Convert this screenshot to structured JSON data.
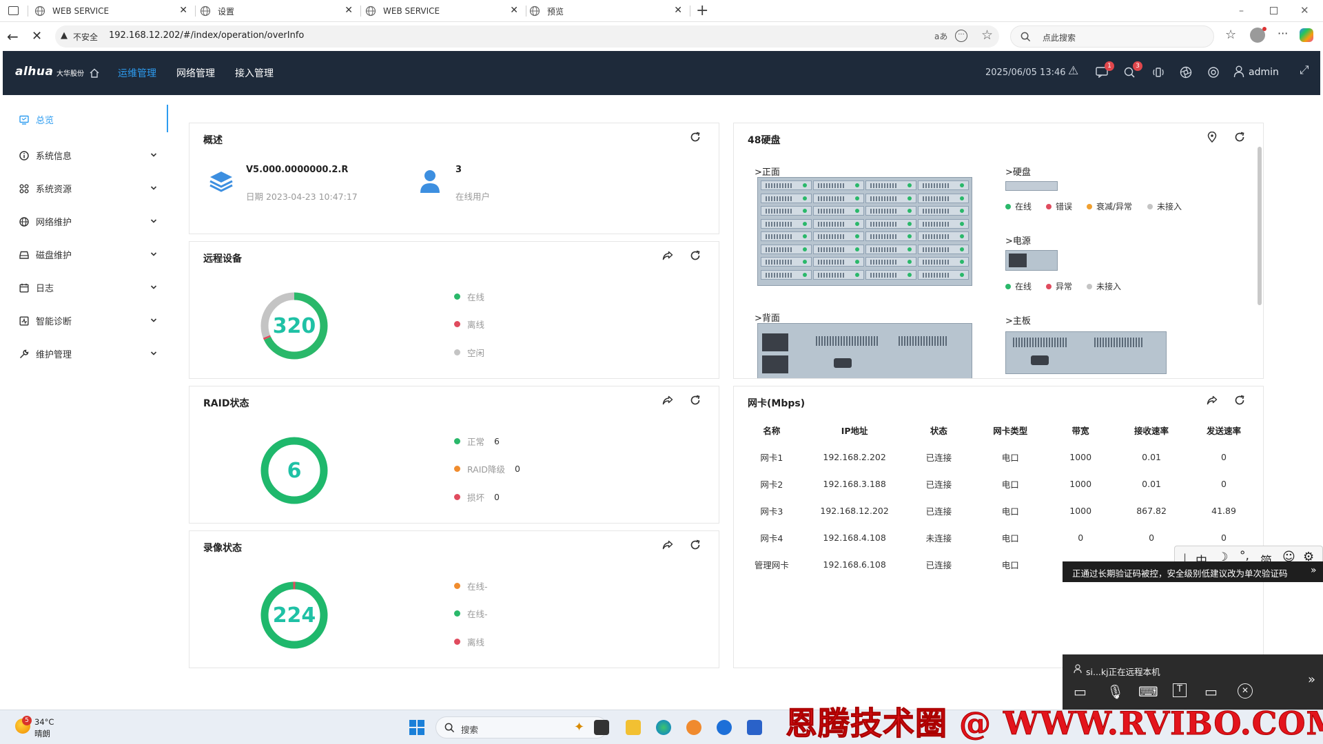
{
  "browser": {
    "tabs": [
      {
        "label": "WEB SERVICE"
      },
      {
        "label": "设置"
      },
      {
        "label": "WEB SERVICE"
      },
      {
        "label": "预览"
      }
    ],
    "insecure_label": "不安全",
    "url": "192.168.12.202/#/index/operation/overInfo",
    "search_placeholder": "点此搜索"
  },
  "header": {
    "brand": "alhua",
    "brand_sub": "大华股份",
    "nav": [
      {
        "label": "运维管理",
        "active": true
      },
      {
        "label": "网络管理",
        "active": false
      },
      {
        "label": "接入管理",
        "active": false
      }
    ],
    "datetime": "2025/06/05 13:46",
    "msg_badge": "1",
    "alert_badge": "3",
    "user": "admin",
    "accent": "#2d9cf0"
  },
  "sidebar": {
    "items": [
      {
        "label": "总览",
        "icon": "monitor-icon"
      },
      {
        "label": "系统信息",
        "icon": "info-icon"
      },
      {
        "label": "系统资源",
        "icon": "grid-icon"
      },
      {
        "label": "网络维护",
        "icon": "globe-icon"
      },
      {
        "label": "磁盘维护",
        "icon": "disk-icon"
      },
      {
        "label": "日志",
        "icon": "calendar-icon"
      },
      {
        "label": "智能诊断",
        "icon": "diagnose-icon"
      },
      {
        "label": "维护管理",
        "icon": "wrench-icon"
      }
    ]
  },
  "overview": {
    "title": "概述",
    "version": "V5.000.0000000.2.R",
    "date_label": "日期 2023-04-23 10:47:17",
    "online_users": "3",
    "online_users_label": "在线用户"
  },
  "remote": {
    "title": "远程设备",
    "total": "320",
    "legend": [
      {
        "label": "在线",
        "color": "#2ab86a"
      },
      {
        "label": "离线",
        "color": "#e04b5e"
      },
      {
        "label": "空闲",
        "color": "#c4c4c4"
      }
    ],
    "segments": [
      {
        "label": "在线",
        "fraction": 0.68,
        "color": "#2ab86a"
      },
      {
        "label": "离线",
        "fraction": 0.01,
        "color": "#e04b5e"
      },
      {
        "label": "空闲",
        "fraction": 0.31,
        "color": "#c4c4c4"
      }
    ]
  },
  "raid": {
    "title": "RAID状态",
    "total": "6",
    "legend": [
      {
        "label": "正常",
        "value": "6",
        "color": "#2ab86a"
      },
      {
        "label": "RAID降级",
        "value": "0",
        "color": "#f08c2e"
      },
      {
        "label": "损坏",
        "value": "0",
        "color": "#e04b5e"
      }
    ]
  },
  "record": {
    "title": "录像状态",
    "total": "224",
    "legend": [
      {
        "label": "在线-",
        "color": "#f08c2e"
      },
      {
        "label": "在线-",
        "color": "#2ab86a"
      },
      {
        "label": "离线",
        "color": "#e04b5e"
      }
    ]
  },
  "disks": {
    "title": "48硬盘",
    "front_label": ">正面",
    "back_label": ">背面",
    "disk_label": ">硬盘",
    "power_label": ">电源",
    "board_label": ">主板",
    "disk_legend": [
      {
        "label": "在线",
        "color": "#2ab86a"
      },
      {
        "label": "错误",
        "color": "#e04b5e"
      },
      {
        "label": "衰减/异常",
        "color": "#f0a030"
      },
      {
        "label": "未接入",
        "color": "#c4c4c4"
      }
    ],
    "power_legend": [
      {
        "label": "在线",
        "color": "#2ab86a"
      },
      {
        "label": "异常",
        "color": "#e04b5e"
      },
      {
        "label": "未接入",
        "color": "#c4c4c4"
      }
    ]
  },
  "nic": {
    "title": "网卡(Mbps)",
    "columns": [
      "名称",
      "IP地址",
      "状态",
      "网卡类型",
      "带宽",
      "接收速率",
      "发送速率"
    ],
    "rows": [
      [
        "网卡1",
        "192.168.2.202",
        "已连接",
        "电口",
        "1000",
        "0.01",
        "0"
      ],
      [
        "网卡2",
        "192.168.3.188",
        "已连接",
        "电口",
        "1000",
        "0.01",
        "0"
      ],
      [
        "网卡3",
        "192.168.12.202",
        "已连接",
        "电口",
        "1000",
        "867.82",
        "41.89"
      ],
      [
        "网卡4",
        "192.168.4.108",
        "未连接",
        "电口",
        "0",
        "0",
        "0"
      ],
      [
        "管理网卡",
        "192.168.6.108",
        "已连接",
        "电口",
        "",
        "",
        ""
      ]
    ]
  },
  "overlays": {
    "ime": [
      "中",
      "简"
    ],
    "toast": "正通过长期验证码被控，安全级别低建议改为单次验证码",
    "remote_session": "si...kj正在远程本机",
    "watermark": "恩腾技术圈 @ WWW.RVIBO.COM"
  },
  "taskbar": {
    "weather_temp": "34°C",
    "weather_desc": "晴朗",
    "weather_badge": "5",
    "search_label": "搜索"
  }
}
